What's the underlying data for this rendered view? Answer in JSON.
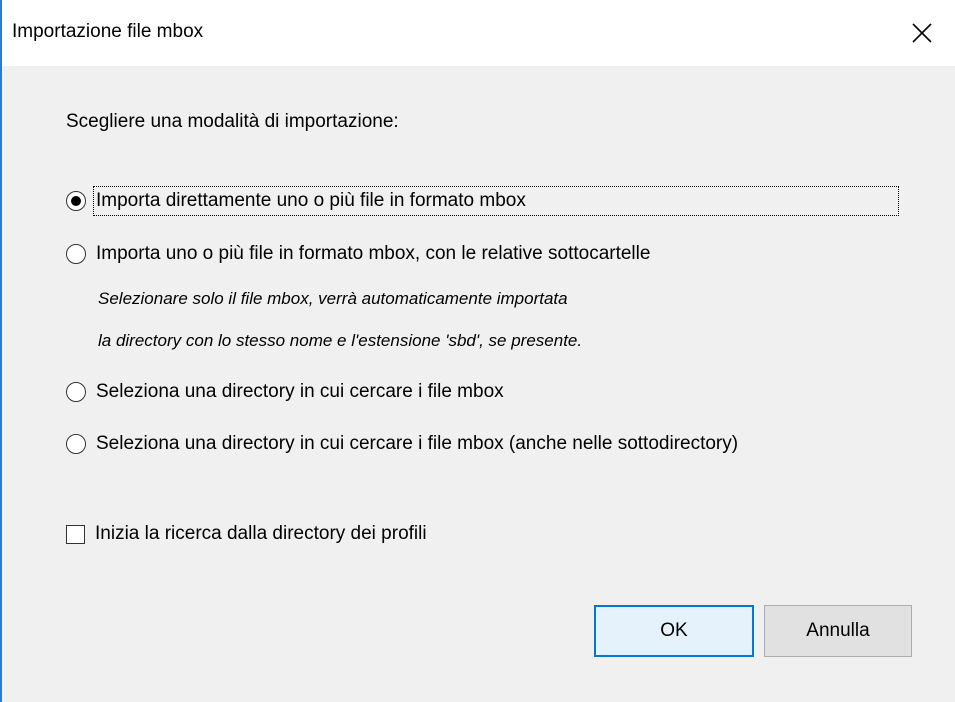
{
  "window": {
    "title": "Importazione file mbox",
    "close_icon": "close-icon"
  },
  "prompt": "Scegliere una modalità di importazione:",
  "options": [
    {
      "label": "Importa direttamente uno o più file in formato mbox",
      "selected": true
    },
    {
      "label": "Importa uno o più file in formato mbox, con le relative sottocartelle",
      "selected": false
    },
    {
      "label": "Seleziona una directory in cui cercare i file mbox",
      "selected": false
    },
    {
      "label": "Seleziona una directory in cui cercare i file mbox (anche nelle sottodirectory)",
      "selected": false
    }
  ],
  "hint": {
    "line1": "Selezionare solo il file mbox, verrà automaticamente importata",
    "line2": "la directory con lo stesso nome e l'estensione 'sbd', se presente."
  },
  "checkbox": {
    "label": "Inizia la ricerca dalla directory dei profili",
    "checked": false
  },
  "buttons": {
    "ok": "OK",
    "cancel": "Annulla"
  },
  "colors": {
    "accent": "#0078d7",
    "window_border": "#2b79d0",
    "background": "#f0f0f0"
  }
}
